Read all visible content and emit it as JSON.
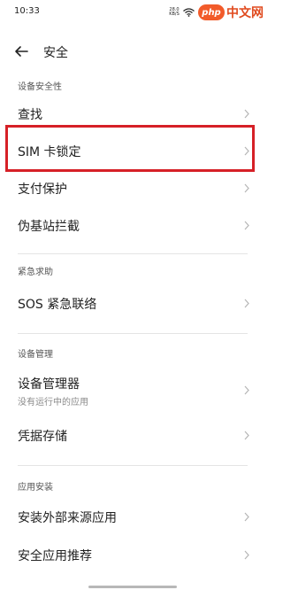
{
  "status_bar": {
    "time": "10:33",
    "speed_value": "28.0",
    "speed_unit": "KB/S"
  },
  "watermark": {
    "logo": "php",
    "text": "中文网"
  },
  "header": {
    "title": "安全"
  },
  "sections": {
    "device_security": {
      "label": "设备安全性",
      "items": [
        {
          "label": "查找"
        },
        {
          "label": "SIM 卡锁定"
        },
        {
          "label": "支付保护"
        },
        {
          "label": "伪基站拦截"
        }
      ]
    },
    "emergency": {
      "label": "紧急求助",
      "items": [
        {
          "label": "SOS 紧急联络"
        }
      ]
    },
    "device_management": {
      "label": "设备管理",
      "items": [
        {
          "label": "设备管理器",
          "sub": "没有运行中的应用"
        },
        {
          "label": "凭据存储"
        }
      ]
    },
    "app_install": {
      "label": "应用安装",
      "items": [
        {
          "label": "安装外部来源应用"
        },
        {
          "label": "安全应用推荐"
        }
      ]
    }
  },
  "colors": {
    "highlight": "#d62027",
    "accent_watermark": "#f25b2a"
  }
}
